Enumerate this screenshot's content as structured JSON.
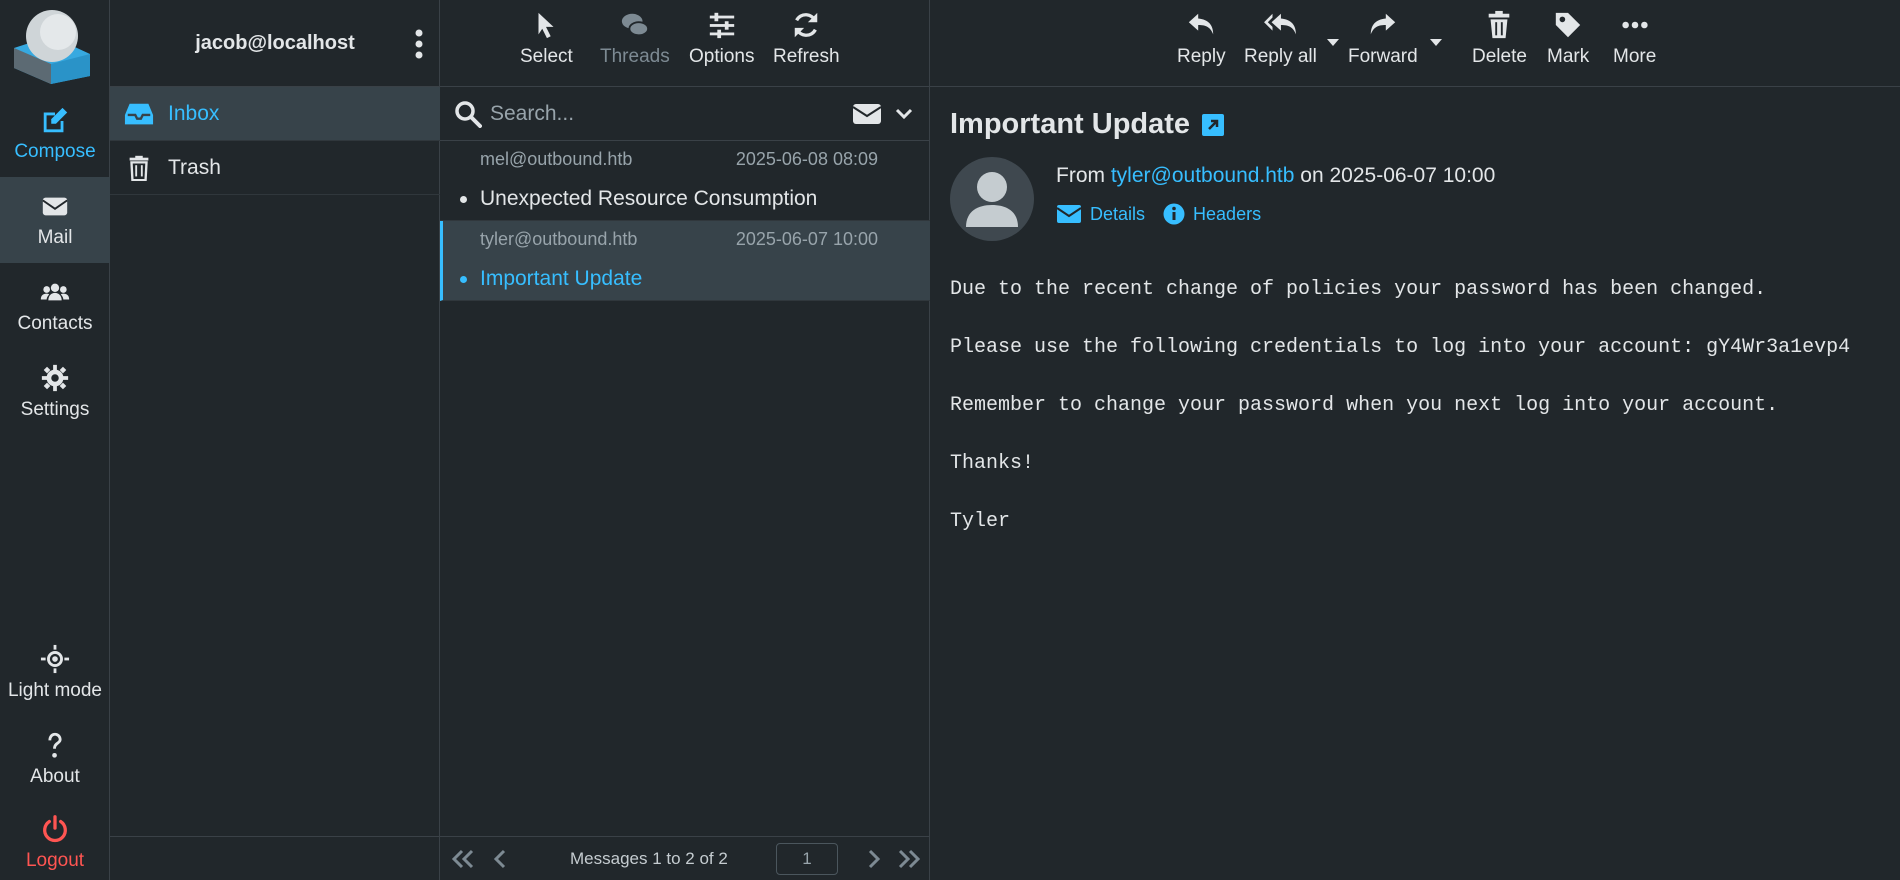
{
  "nav": {
    "compose": "Compose",
    "mail": "Mail",
    "contacts": "Contacts",
    "settings": "Settings",
    "light_mode": "Light mode",
    "about": "About",
    "logout": "Logout"
  },
  "account": "jacob@localhost",
  "folders": [
    {
      "label": "Inbox"
    },
    {
      "label": "Trash"
    }
  ],
  "list_toolbar": {
    "select": "Select",
    "threads": "Threads",
    "options": "Options",
    "refresh": "Refresh"
  },
  "search": {
    "placeholder": "Search..."
  },
  "messages": [
    {
      "from": "mel@outbound.htb",
      "date": "2025-06-08 08:09",
      "subject": "Unexpected Resource Consumption"
    },
    {
      "from": "tyler@outbound.htb",
      "date": "2025-06-07 10:00",
      "subject": "Important Update"
    }
  ],
  "pager": {
    "summary": "Messages 1 to 2 of 2",
    "page": "1"
  },
  "view_toolbar": {
    "reply": "Reply",
    "reply_all": "Reply all",
    "forward": "Forward",
    "delete": "Delete",
    "mark": "Mark",
    "more": "More"
  },
  "message": {
    "subject": "Important Update",
    "from_prefix": "From",
    "from_addr": "tyler@outbound.htb",
    "on_date": "on 2025-06-07 10:00",
    "details": "Details",
    "headers": "Headers",
    "body": "Due to the recent change of policies your password has been changed.\n\nPlease use the following credentials to log into your account: gY4Wr3a1evp4\n\nRemember to change your password when you next log into your account.\n\nThanks!\n\nTyler"
  },
  "colors": {
    "accent": "#37beff",
    "logout": "#ff5552",
    "background": "#21272b",
    "selected": "#37434a"
  }
}
